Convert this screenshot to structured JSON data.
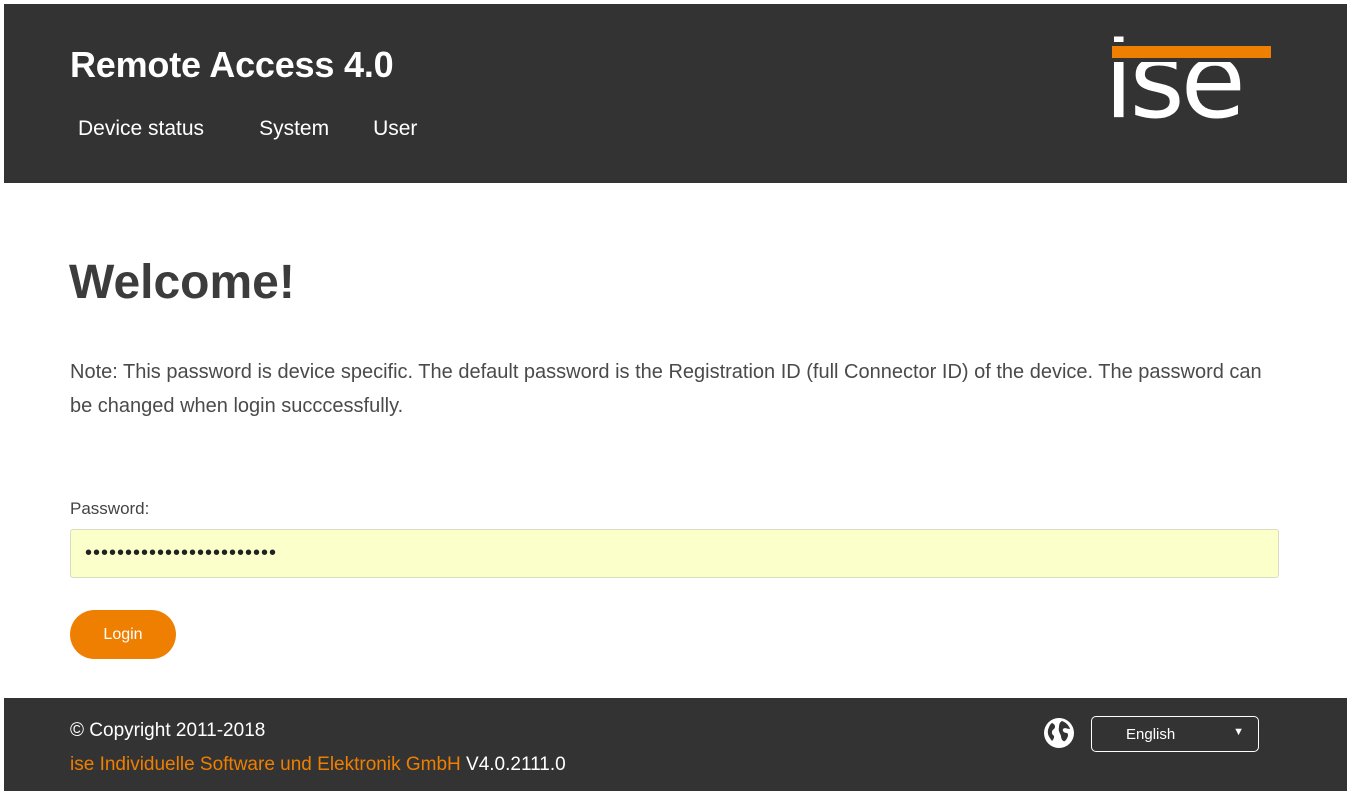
{
  "header": {
    "title": "Remote Access 4.0",
    "nav": [
      "Device status",
      "System",
      "User"
    ],
    "logo_text": "ise"
  },
  "main": {
    "heading": "Welcome!",
    "note": "Note: This password is device specific. The default password is the Registration ID (full Connector ID) of the device. The password can be changed when login succcessfully.",
    "password_label": "Password:",
    "password_value": "••••••••••••••••••••••••",
    "login_label": "Login"
  },
  "footer": {
    "copyright": "© Copyright 2011-2018",
    "company": "ise Individuelle Software und Elektronik GmbH",
    "version": "V4.0.2111.0",
    "language": "English",
    "globe_icon": "globe-icon",
    "dropdown_icon": "triangle-down-icon"
  },
  "colors": {
    "header_bg": "#333333",
    "accent": "#ee7f00",
    "input_bg": "#fbffc9"
  }
}
